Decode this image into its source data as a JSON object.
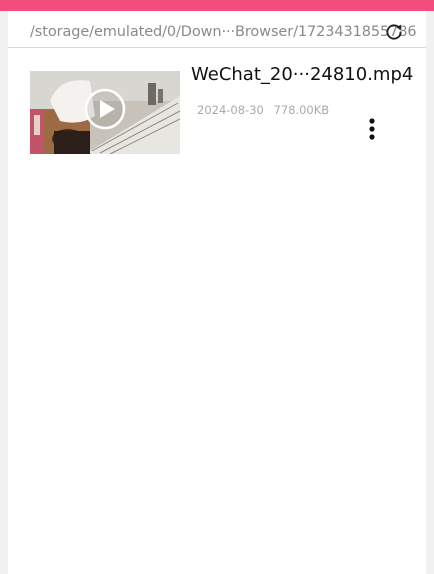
{
  "colors": {
    "accent_bar": "#f24d7d",
    "path_text": "#8a8a8a",
    "meta_text": "#aaaaaa"
  },
  "path_bar": {
    "path": "/storage/emulated/0/Down···Browser/1723431855786",
    "refresh_icon": "refresh-icon"
  },
  "files": [
    {
      "name": "WeChat_20···24810.mp4",
      "date": "2024-08-30",
      "size": "778.00KB",
      "thumbnail_icon": "play-icon",
      "menu_icon": "more-vertical-icon"
    }
  ]
}
